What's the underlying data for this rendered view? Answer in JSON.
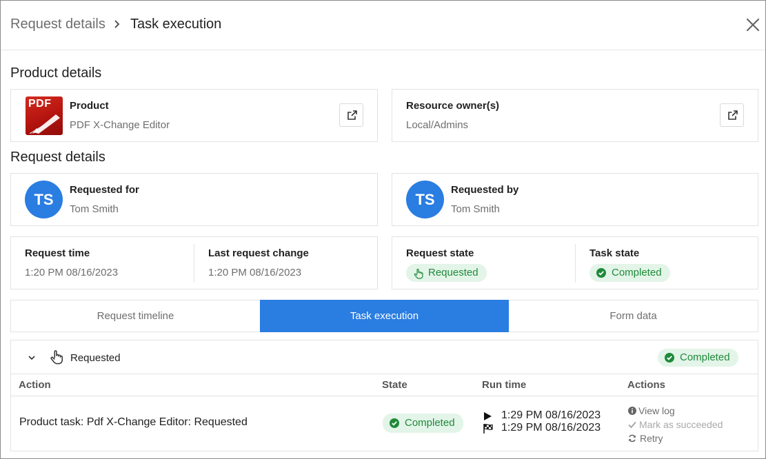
{
  "header": {
    "breadcrumb_parent": "Request details",
    "breadcrumb_current": "Task execution"
  },
  "product_section": {
    "title": "Product details",
    "product": {
      "label": "Product",
      "value": "PDF X-Change Editor",
      "logo_text": "PDF"
    },
    "owner": {
      "label": "Resource owner(s)",
      "value": "Local/Admins"
    }
  },
  "request_section": {
    "title": "Request details",
    "requested_for": {
      "label": "Requested for",
      "value": "Tom Smith",
      "initials": "TS"
    },
    "requested_by": {
      "label": "Requested by",
      "value": "Tom Smith",
      "initials": "TS"
    },
    "request_time": {
      "label": "Request time",
      "value": "1:20 PM 08/16/2023"
    },
    "last_change": {
      "label": "Last request change",
      "value": "1:20 PM 08/16/2023"
    },
    "request_state": {
      "label": "Request state",
      "value": "Requested"
    },
    "task_state": {
      "label": "Task state",
      "value": "Completed"
    }
  },
  "tabs": [
    {
      "label": "Request timeline",
      "active": false
    },
    {
      "label": "Task execution",
      "active": true
    },
    {
      "label": "Form data",
      "active": false
    }
  ],
  "execution": {
    "group_label": "Requested",
    "group_status": "Completed",
    "columns": {
      "action": "Action",
      "state": "State",
      "run_time": "Run time",
      "actions": "Actions"
    },
    "rows": [
      {
        "action": "Product task: Pdf X-Change Editor: Requested",
        "state": "Completed",
        "started": "1:29 PM 08/16/2023",
        "finished": "1:29 PM 08/16/2023",
        "actions": {
          "view_log": "View log",
          "mark_succeeded": "Mark as succeeded",
          "retry": "Retry"
        }
      }
    ]
  },
  "colors": {
    "accent": "#2a7de1",
    "success_bg": "#e3f4e8",
    "success_fg": "#1f8a3a",
    "pdf_red": "#c41e15"
  },
  "icons": {
    "close": "close-icon",
    "external_link": "external-link-icon",
    "hand": "hand-pointer-icon",
    "check": "check-circle-icon",
    "play": "play-icon",
    "flag": "checkered-flag-icon",
    "info": "info-icon",
    "checkmark": "checkmark-icon",
    "retry": "refresh-icon",
    "chevron": "chevron-down-icon"
  }
}
